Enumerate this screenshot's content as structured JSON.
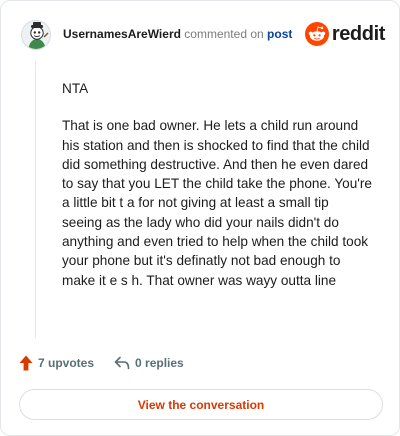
{
  "header": {
    "username": "UsernamesAreWierd",
    "action_text": "commented on",
    "post_link": "post",
    "logo_text": "reddit"
  },
  "comment": {
    "paragraphs": [
      "NTA",
      "That is one bad owner. He lets a child run around his station and then is shocked to find that the child did something destructive. And then he even dared to say that you LET the child take the phone. You're a little bit t a for not giving at least a small tip seeing as the lady who did your nails didn't do anything and even tried to help when the child took your phone but it's definatly not bad enough to make it e s h. That owner was wayy outta line"
    ]
  },
  "actions": {
    "upvotes": "7 upvotes",
    "replies": "0 replies"
  },
  "footer": {
    "view_button": "View the conversation"
  },
  "colors": {
    "brand": "#ff4500",
    "link": "#0a449b",
    "button_text": "#d93a00",
    "muted": "#576f76"
  },
  "icons": {
    "logo": "reddit-snoo-icon",
    "upvote": "upvote-arrow-icon",
    "reply": "reply-arrow-icon",
    "avatar": "user-avatar"
  }
}
